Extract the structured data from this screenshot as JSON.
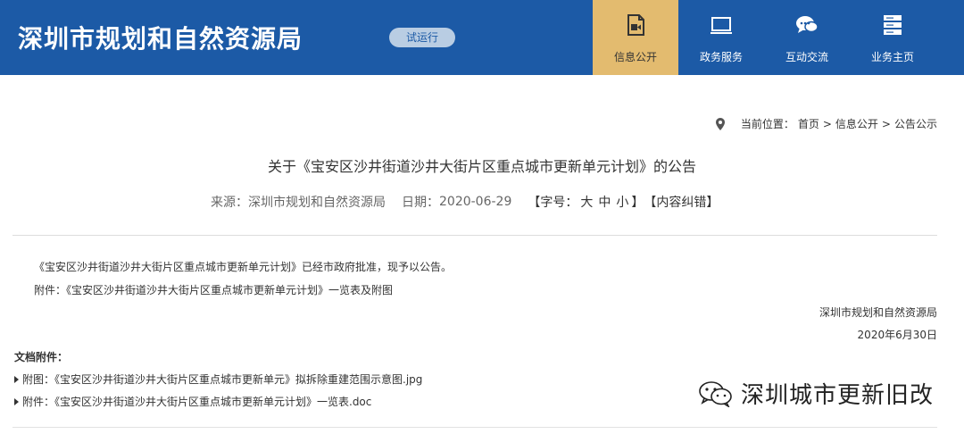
{
  "header": {
    "site_title": "深圳市规划和自然资源局",
    "trial_badge": "试运行",
    "brand_color": "#1c5aa6",
    "nav": [
      {
        "label": "信息公开",
        "icon": "document-video-icon",
        "active": true
      },
      {
        "label": "政务服务",
        "icon": "monitor-icon",
        "active": false
      },
      {
        "label": "互动交流",
        "icon": "chat-bubbles-icon",
        "active": false
      },
      {
        "label": "业务主页",
        "icon": "server-stack-icon",
        "active": false
      }
    ]
  },
  "breadcrumb": {
    "prefix": "当前位置：",
    "items": [
      "首页",
      "信息公开",
      "公告公示"
    ],
    "separator": ">"
  },
  "article": {
    "title": "关于《宝安区沙井街道沙井大街片区重点城市更新单元计划》的公告",
    "meta": {
      "source_label": "来源：",
      "source": "深圳市规划和自然资源局",
      "date_label": "日期：",
      "date": "2020-06-29",
      "font_size_label": "【字号：",
      "size_large": "大",
      "size_medium": "中",
      "size_small": "小",
      "font_size_close": "】",
      "correction": "【内容纠错】"
    },
    "paragraphs": [
      "《宝安区沙井街道沙井大街片区重点城市更新单元计划》已经市政府批准，现予以公告。",
      "附件：《宝安区沙井街道沙井大街片区重点城市更新单元计划》一览表及附图"
    ],
    "signature_org": "深圳市规划和自然资源局",
    "signature_date": "2020年6月30日",
    "attachments_heading": "文档附件：",
    "attachments": [
      "附图：《宝安区沙井街道沙井大街片区重点城市更新单元》拟拆除重建范围示意图.jpg",
      "附件：《宝安区沙井街道沙井大街片区重点城市更新单元计划》一览表.doc"
    ]
  },
  "watermark": {
    "text": "深圳城市更新旧改",
    "icon": "wechat-icon"
  }
}
